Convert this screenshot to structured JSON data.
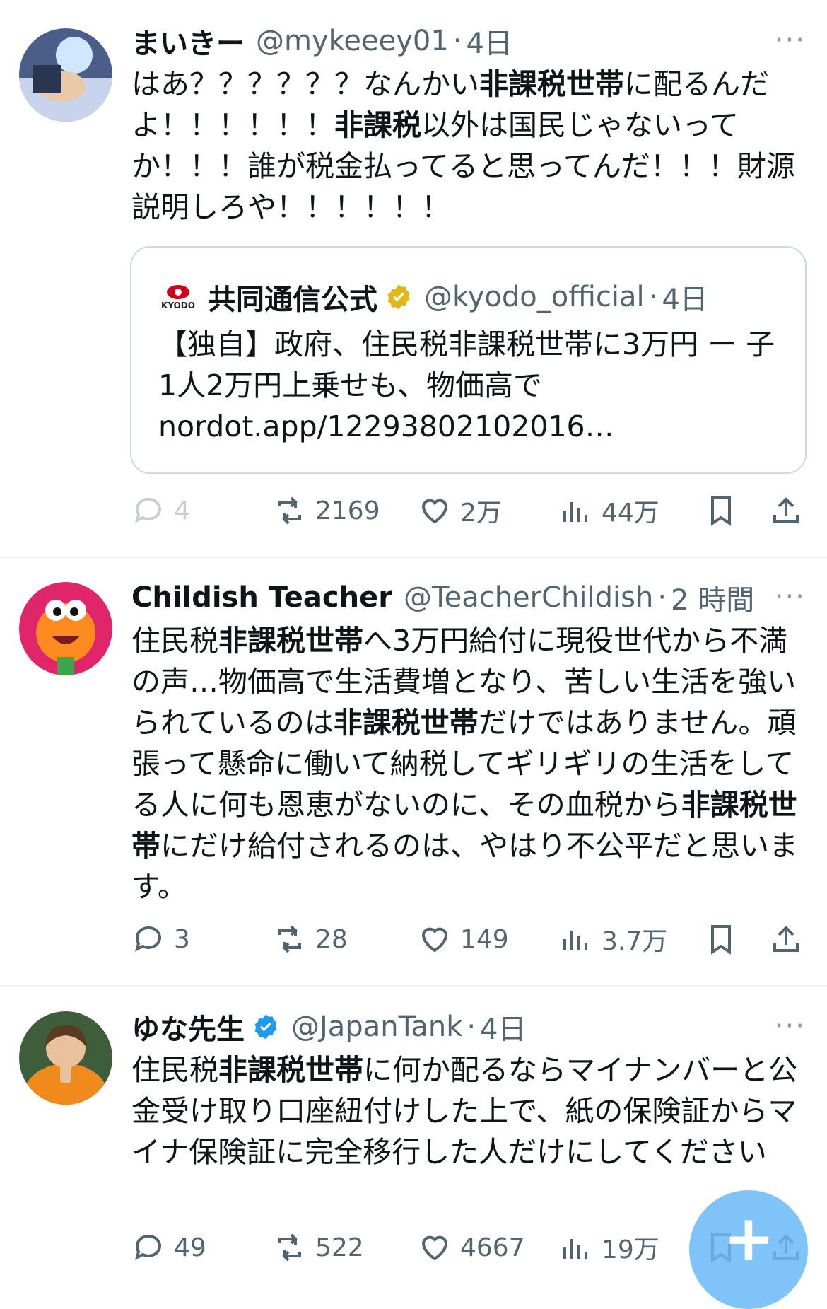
{
  "tweets": [
    {
      "name": "まいきー",
      "handle": "@mykeeey01",
      "time": "4日",
      "more": "···",
      "text_parts": [
        "はあ？？？？？？なんかい",
        "非課税世帯",
        "に配るんだよ！！！！！！",
        "非課税",
        "以外は国民じゃないってか！！！誰が税金払ってると思ってんだ！！！財源説明しろや！！！！！！"
      ],
      "quote": {
        "logo_text": "KYODO",
        "name": "共同通信公式",
        "handle": "@kyodo_official",
        "time": "4日",
        "text": "【独自】政府、住民税非課税世帯に3万円 ー 子1人2万円上乗せも、物価高で nordot.app/12293802102016…"
      },
      "stats": {
        "replies": "4",
        "retweets": "2169",
        "likes": "2万",
        "views": "44万"
      }
    },
    {
      "name": "Childish Teacher",
      "handle": "@TeacherChildish",
      "time": "2 時間",
      "more": "···",
      "text_parts": [
        "住民税",
        "非課税世帯",
        "へ3万円給付に現役世代から不満の声…物価高で生活費増となり、苦しい生活を強いられているのは",
        "非課税世帯",
        "だけではありません。頑張って懸命に働いて納税してギリギリの生活をしてる人に何も恩恵がないのに、その血税から",
        "非課税世帯",
        "にだけ給付されるのは、やはり不公平だと思います。"
      ],
      "stats": {
        "replies": "3",
        "retweets": "28",
        "likes": "149",
        "views": "3.7万"
      }
    },
    {
      "name": "ゆな先生",
      "handle": "@JapanTank",
      "time": "4日",
      "more": "···",
      "text_parts": [
        "住民税",
        "非課税世帯",
        "に何か配るならマイナンバーと公金受け取り口座紐付けした上で、紙の保険証からマイナ保険証に完全移行した人だけにしてください"
      ],
      "stats": {
        "replies": "49",
        "retweets": "522",
        "likes": "4667",
        "views": "19万"
      }
    }
  ],
  "fab": {
    "label": "+"
  },
  "colors": {
    "verified_blue": "#1d9bf0",
    "verified_gold": "#e2b719",
    "fab": "#69b9f7",
    "secondary_text": "#536471"
  }
}
